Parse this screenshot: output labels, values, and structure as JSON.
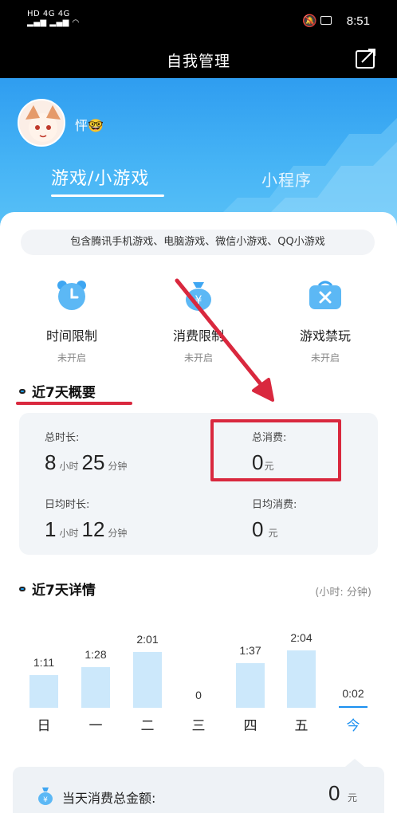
{
  "status_bar": {
    "left": "HD 4G 4G",
    "time": "8:51"
  },
  "header": {
    "title": "自我管理"
  },
  "profile": {
    "username": "怦🤓"
  },
  "tabs": {
    "game": "游戏/小游戏",
    "mini": "小程序"
  },
  "include_note": "包含腾讯手机游戏、电脑游戏、微信小游戏、QQ小游戏",
  "controls": [
    {
      "name": "时间限制",
      "state": "未开启",
      "icon": "alarm-clock-icon"
    },
    {
      "name": "消费限制",
      "state": "未开启",
      "icon": "money-bag-icon"
    },
    {
      "name": "游戏禁玩",
      "state": "未开启",
      "icon": "ban-box-icon"
    }
  ],
  "summary": {
    "title": "近7天概要",
    "total_time_label": "总时长:",
    "total_time_hours": "8",
    "total_time_minutes": "25",
    "total_spend_label": "总消费:",
    "total_spend_value": "0",
    "daily_time_label": "日均时长:",
    "daily_time_hours": "1",
    "daily_time_minutes": "12",
    "daily_spend_label": "日均消费:",
    "daily_spend_value": "0",
    "unit_hour": "小时",
    "unit_minute": "分钟",
    "unit_yuan": "元"
  },
  "details": {
    "title": "近7天详情",
    "unit_note": "(小时: 分钟)"
  },
  "chart_data": {
    "type": "bar",
    "categories": [
      "日",
      "一",
      "二",
      "三",
      "四",
      "五",
      "今"
    ],
    "labels": [
      "1:11",
      "1:28",
      "2:01",
      "0",
      "1:37",
      "2:04",
      "0:02"
    ],
    "values": [
      71,
      88,
      121,
      0,
      97,
      124,
      2
    ],
    "highlight": "今",
    "colors": {
      "bar": "#cce8fb",
      "today": "#1a8ff0"
    }
  },
  "today_spend": {
    "label": "当天消费总金额:",
    "value": "0",
    "unit": "元"
  },
  "colors": {
    "accent": "#2f9df0",
    "highlight": "#d9283e"
  }
}
